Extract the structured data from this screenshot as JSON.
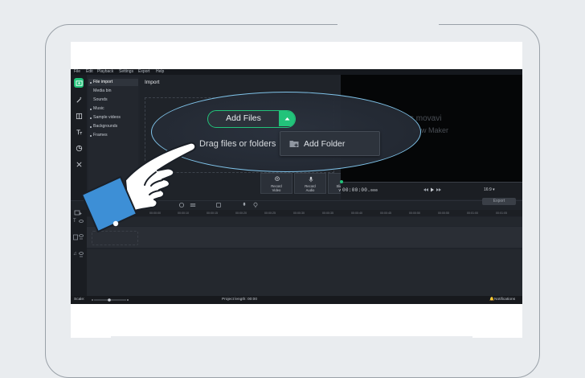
{
  "menubar": {
    "items": [
      "File",
      "Edit",
      "Playback",
      "Settings",
      "Export",
      "Help"
    ]
  },
  "sidebar": {
    "items": [
      {
        "label": "File import",
        "selected": true
      },
      {
        "label": "Media bin"
      },
      {
        "label": "Sounds"
      },
      {
        "label": "Music"
      },
      {
        "label": "Sample videos"
      },
      {
        "label": "Backgrounds"
      },
      {
        "label": "Frames"
      }
    ]
  },
  "import": {
    "title": "Import",
    "add_files_label": "Add Files",
    "drag_text": "Drag files or folders",
    "add_folder_label": "Add Folder",
    "tiles": [
      {
        "line1": "Record",
        "line2": "Video"
      },
      {
        "line1": "Record",
        "line2": "Audio"
      },
      {
        "line1": "Slideshow",
        "line2": "Wizard"
      }
    ]
  },
  "player": {
    "logo_line1": "s movavi",
    "logo_line2": "how Maker",
    "timecode": "00:00:00",
    "timecode_frac": "000",
    "aspect_ratio": "16:9"
  },
  "toolbar": {
    "export_label": "Export"
  },
  "timeline": {
    "ruler_ticks": [
      "00:00:00",
      "00:00:10",
      "00:00:15",
      "00:00:20",
      "00:00:25",
      "00:00:30",
      "00:00:35",
      "00:00:40",
      "00:00:45",
      "00:00:50",
      "00:00:55",
      "00:01:00",
      "00:01:05",
      "00:01:10",
      "00:01:15"
    ]
  },
  "status": {
    "scale_label": "Scale:",
    "project_length": "Project length: 00:00",
    "notifications": "Notifications"
  },
  "colors": {
    "accent": "#22c37a",
    "highlight_ring": "#7fc2e8",
    "cuff": "#3d8fd6"
  }
}
